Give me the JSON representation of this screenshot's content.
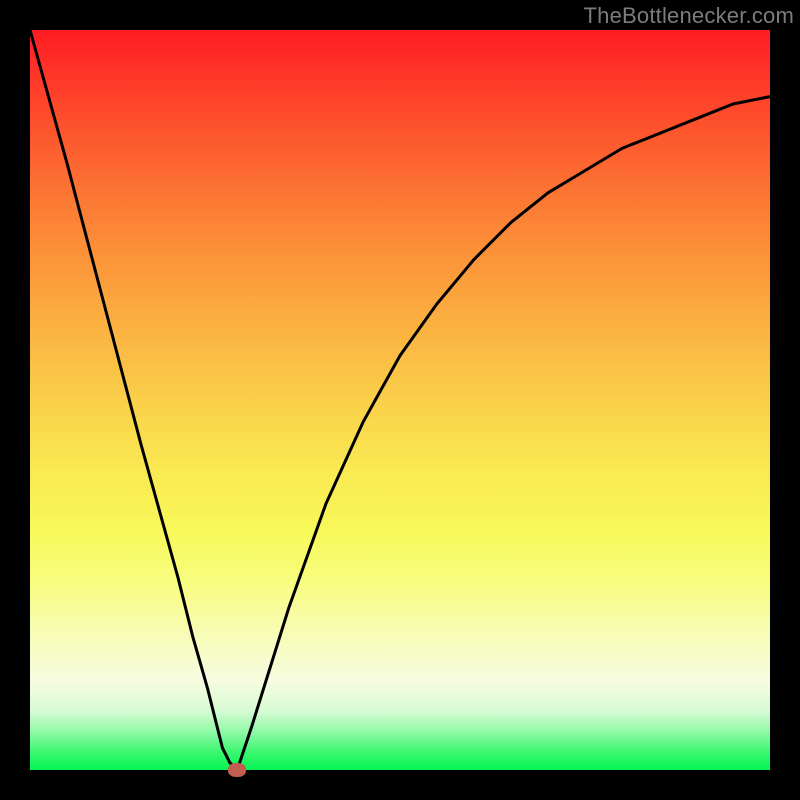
{
  "watermark": "TheBottlenecker.com",
  "chart_data": {
    "type": "line",
    "title": "",
    "xlabel": "",
    "ylabel": "",
    "xlim": [
      0,
      100
    ],
    "ylim": [
      0,
      100
    ],
    "x": [
      0,
      5,
      10,
      15,
      20,
      22,
      24,
      25,
      26,
      27,
      28,
      30,
      35,
      40,
      45,
      50,
      55,
      60,
      65,
      70,
      75,
      80,
      85,
      90,
      95,
      100
    ],
    "values": [
      100,
      82,
      63,
      44,
      26,
      18,
      11,
      7,
      3,
      1,
      0,
      6,
      22,
      36,
      47,
      56,
      63,
      69,
      74,
      78,
      81,
      84,
      86,
      88,
      90,
      91
    ],
    "marker": {
      "x": 28,
      "y": 0
    },
    "gradient_stops": [
      {
        "pos": 0,
        "color": "#fe1b23"
      },
      {
        "pos": 50,
        "color": "#fad24a"
      },
      {
        "pos": 100,
        "color": "#05f552"
      }
    ]
  }
}
